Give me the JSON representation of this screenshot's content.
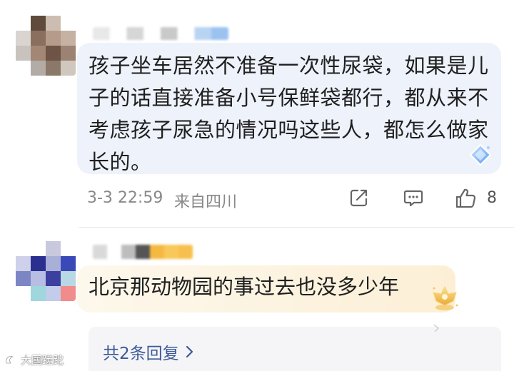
{
  "comments": [
    {
      "avatar": {
        "pixels": [
          "#ffffff",
          "#5f4a3c",
          "#cdbdb1",
          "#ffffff",
          "#d9d4d0",
          "#8a6f5e",
          "#b59c8a",
          "#c5b2a3",
          "#c8c3bf",
          "#a38774",
          "#6d5446",
          "#9c8272",
          "#ffffff",
          "#b2aba6",
          "#8c7868",
          "#d0c7bf"
        ]
      },
      "name_colors": [
        "#e8e8e8",
        "#ffffff",
        "#d6d6d6",
        "#ffffff",
        "#c9c9c9",
        "#ffffff",
        "#b9d3f3",
        "#9cc3f0"
      ],
      "text": "孩子坐车居然不准备一次性尿袋，如果是儿子的话直接准备小号保鲜袋都行，都从来不考虑孩子尿急的情况吗这些人，都怎么做家长的。",
      "bubble_color": "#eef2fb",
      "date": "3-3 22:59",
      "location": "来自四川",
      "like_count": "8"
    },
    {
      "avatar": {
        "pixels": [
          "#ffffff",
          "#ffffff",
          "#c8c9df",
          "#ffffff",
          "#cfd0ea",
          "#2b2f8f",
          "#a8b0d8",
          "#3b49b8",
          "#7d86c4",
          "#b7bde3",
          "#3a3fa0",
          "#b8d9e3",
          "#ffffff",
          "#9fd7dc",
          "#c3ccea",
          "#f08c8c"
        ]
      },
      "name_colors": [
        "#d9d9d9",
        "#ffffff",
        "#bdbdbd",
        "#555555",
        "#f5b942",
        "#f9c85a",
        "#f7c04e"
      ],
      "text": "北京那动物园的事过去也没多少年",
      "replies_label": "共2条回复"
    }
  ],
  "watermark": "大國蹉跎",
  "colors": {
    "meta_text": "#888888",
    "link": "#3b5998",
    "replies_bg": "#f5f5f7"
  },
  "icons": [
    "share-icon",
    "comment-icon",
    "like-icon",
    "diamond-badge-icon",
    "crown-badge-icon",
    "chevron-right-icon"
  ]
}
